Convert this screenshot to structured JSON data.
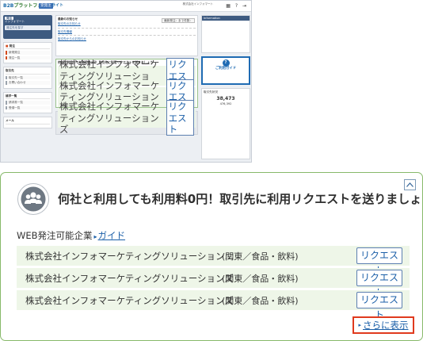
{
  "thumbnail": {
    "header": {
      "logo_b2b": "B2B",
      "logo_rest": "プラットフォーム",
      "plan_badge": "受発注",
      "plan_name": "ライト",
      "company": "株式会社インフォマート",
      "header_icons": "▦ ? ⇥"
    },
    "sidebar": {
      "user_tag": "発注",
      "user_name": "インフォマート",
      "user_button": "発注先を探す",
      "sections": [
        {
          "title": "発注",
          "items": [
            "新規発注",
            "発注一覧"
          ]
        },
        {
          "title": "取引先",
          "items": [
            "取引先一覧",
            "お問い合わせ"
          ]
        },
        {
          "title": "請求一覧",
          "items": [
            "請求書一覧",
            "受領一覧"
          ]
        },
        {
          "title": "メール",
          "items": []
        }
      ]
    },
    "main": {
      "notice_title": "最新のお知らせ",
      "notice_select": "最新発注：まで件数：",
      "notice_links": [
        "取引先のお知らせ",
        "取引先情報",
        "取引先からのお知らせ"
      ],
      "promo_head": "何社と利用しても利用料0円！取引先に利用リクエストを送りましょう",
      "bottom_title": "取引ページ"
    },
    "right": {
      "info_title": "Information",
      "guide_text": "ご利用ガイド",
      "status_title": "取引先状況",
      "status_value": "38,473",
      "status_sub": "476,392"
    }
  },
  "promo": {
    "title": "何社と利用しても利用料0円！取引先に利用リクエストを送りましょう",
    "web_label": "WEB発注可能企業",
    "guide_link": "ガイド",
    "rows": [
      {
        "company": "株式会社インフォマーケティングソリューション…",
        "region": "(関東／食品・飲料)",
        "button": "リクエスト"
      },
      {
        "company": "株式会社インフォマーケティングソリューションズ",
        "region": "(関東／食品・飲料)",
        "button": "リクエスト"
      },
      {
        "company": "株式会社インフォマーケティングソリューションズ",
        "region": "(関東／食品・飲料)",
        "button": "リクエスト"
      }
    ],
    "more_link": "さらに表示",
    "accent_color": "#87b96a",
    "highlight_color": "#e03a1e"
  }
}
